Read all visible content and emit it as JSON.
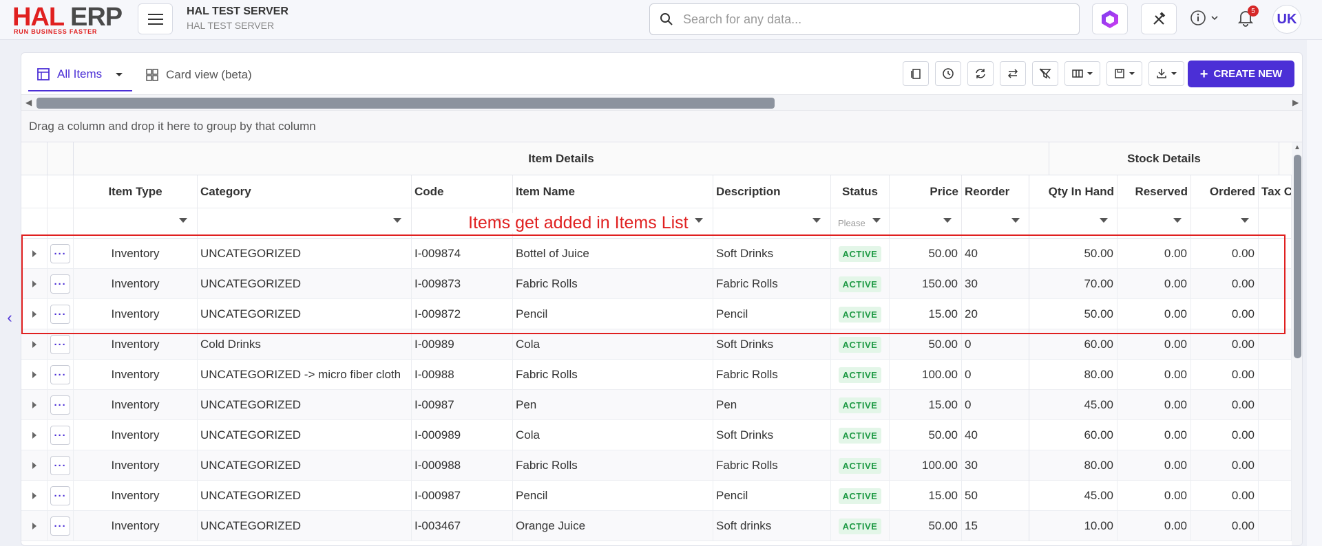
{
  "app": {
    "logo_main": "HAL ERP",
    "logo_hal": "HAL",
    "logo_erp": "ERP",
    "logo_tagline": "RUN BUSINESS FASTER",
    "server_title": "HAL TEST SERVER",
    "server_subtitle": "HAL TEST SERVER",
    "search_placeholder": "Search for any data...",
    "notification_count": "5",
    "user_initials": "UK",
    "accent_color": "#4b2fd6"
  },
  "view_tabs": {
    "all_items": "All Items",
    "card_view": "Card view (beta)"
  },
  "toolbar": {
    "create_new": "CREATE NEW"
  },
  "group_bar_text": "Drag a column and drop it here to group by that column",
  "grid": {
    "group_headers": {
      "item_details": "Item Details",
      "stock_details": "Stock Details"
    },
    "columns": [
      "Item Type",
      "Category",
      "Code",
      "Item Name",
      "Description",
      "Status",
      "Price",
      "Reorder",
      "Qty In Hand",
      "Reserved",
      "Ordered",
      "Tax C"
    ],
    "status_filter_placeholder": "Please",
    "rows": [
      {
        "type": "Inventory",
        "category": "UNCATEGORIZED",
        "code": "I-009874",
        "name": "Bottel of Juice",
        "description": "Soft Drinks",
        "status": "ACTIVE",
        "price": "50.00",
        "reorder": "40",
        "qty": "50.00",
        "reserved": "0.00",
        "ordered": "0.00"
      },
      {
        "type": "Inventory",
        "category": "UNCATEGORIZED",
        "code": "I-009873",
        "name": "Fabric Rolls",
        "description": "Fabric Rolls",
        "status": "ACTIVE",
        "price": "150.00",
        "reorder": "30",
        "qty": "70.00",
        "reserved": "0.00",
        "ordered": "0.00"
      },
      {
        "type": "Inventory",
        "category": "UNCATEGORIZED",
        "code": "I-009872",
        "name": "Pencil",
        "description": "Pencil",
        "status": "ACTIVE",
        "price": "15.00",
        "reorder": "20",
        "qty": "50.00",
        "reserved": "0.00",
        "ordered": "0.00"
      },
      {
        "type": "Inventory",
        "category": "Cold Drinks",
        "code": "I-00989",
        "name": "Cola",
        "description": "Soft Drinks",
        "status": "ACTIVE",
        "price": "50.00",
        "reorder": "0",
        "qty": "60.00",
        "reserved": "0.00",
        "ordered": "0.00"
      },
      {
        "type": "Inventory",
        "category": "UNCATEGORIZED -> micro fiber cloth",
        "code": "I-00988",
        "name": "Fabric Rolls",
        "description": "Fabric Rolls",
        "status": "ACTIVE",
        "price": "100.00",
        "reorder": "0",
        "qty": "80.00",
        "reserved": "0.00",
        "ordered": "0.00"
      },
      {
        "type": "Inventory",
        "category": "UNCATEGORIZED",
        "code": "I-00987",
        "name": "Pen",
        "description": "Pen",
        "status": "ACTIVE",
        "price": "15.00",
        "reorder": "0",
        "qty": "45.00",
        "reserved": "0.00",
        "ordered": "0.00"
      },
      {
        "type": "Inventory",
        "category": "UNCATEGORIZED",
        "code": "I-000989",
        "name": "Cola",
        "description": "Soft Drinks",
        "status": "ACTIVE",
        "price": "50.00",
        "reorder": "40",
        "qty": "60.00",
        "reserved": "0.00",
        "ordered": "0.00"
      },
      {
        "type": "Inventory",
        "category": "UNCATEGORIZED",
        "code": "I-000988",
        "name": "Fabric Rolls",
        "description": "Fabric Rolls",
        "status": "ACTIVE",
        "price": "100.00",
        "reorder": "30",
        "qty": "80.00",
        "reserved": "0.00",
        "ordered": "0.00"
      },
      {
        "type": "Inventory",
        "category": "UNCATEGORIZED",
        "code": "I-000987",
        "name": "Pencil",
        "description": "Pencil",
        "status": "ACTIVE",
        "price": "15.00",
        "reorder": "50",
        "qty": "45.00",
        "reserved": "0.00",
        "ordered": "0.00"
      },
      {
        "type": "Inventory",
        "category": "UNCATEGORIZED",
        "code": "I-003467",
        "name": "Orange Juice",
        "description": "Soft drinks",
        "status": "ACTIVE",
        "price": "50.00",
        "reorder": "15",
        "qty": "10.00",
        "reserved": "0.00",
        "ordered": "0.00"
      }
    ]
  },
  "annotation": {
    "note": "Items get added in Items List"
  }
}
